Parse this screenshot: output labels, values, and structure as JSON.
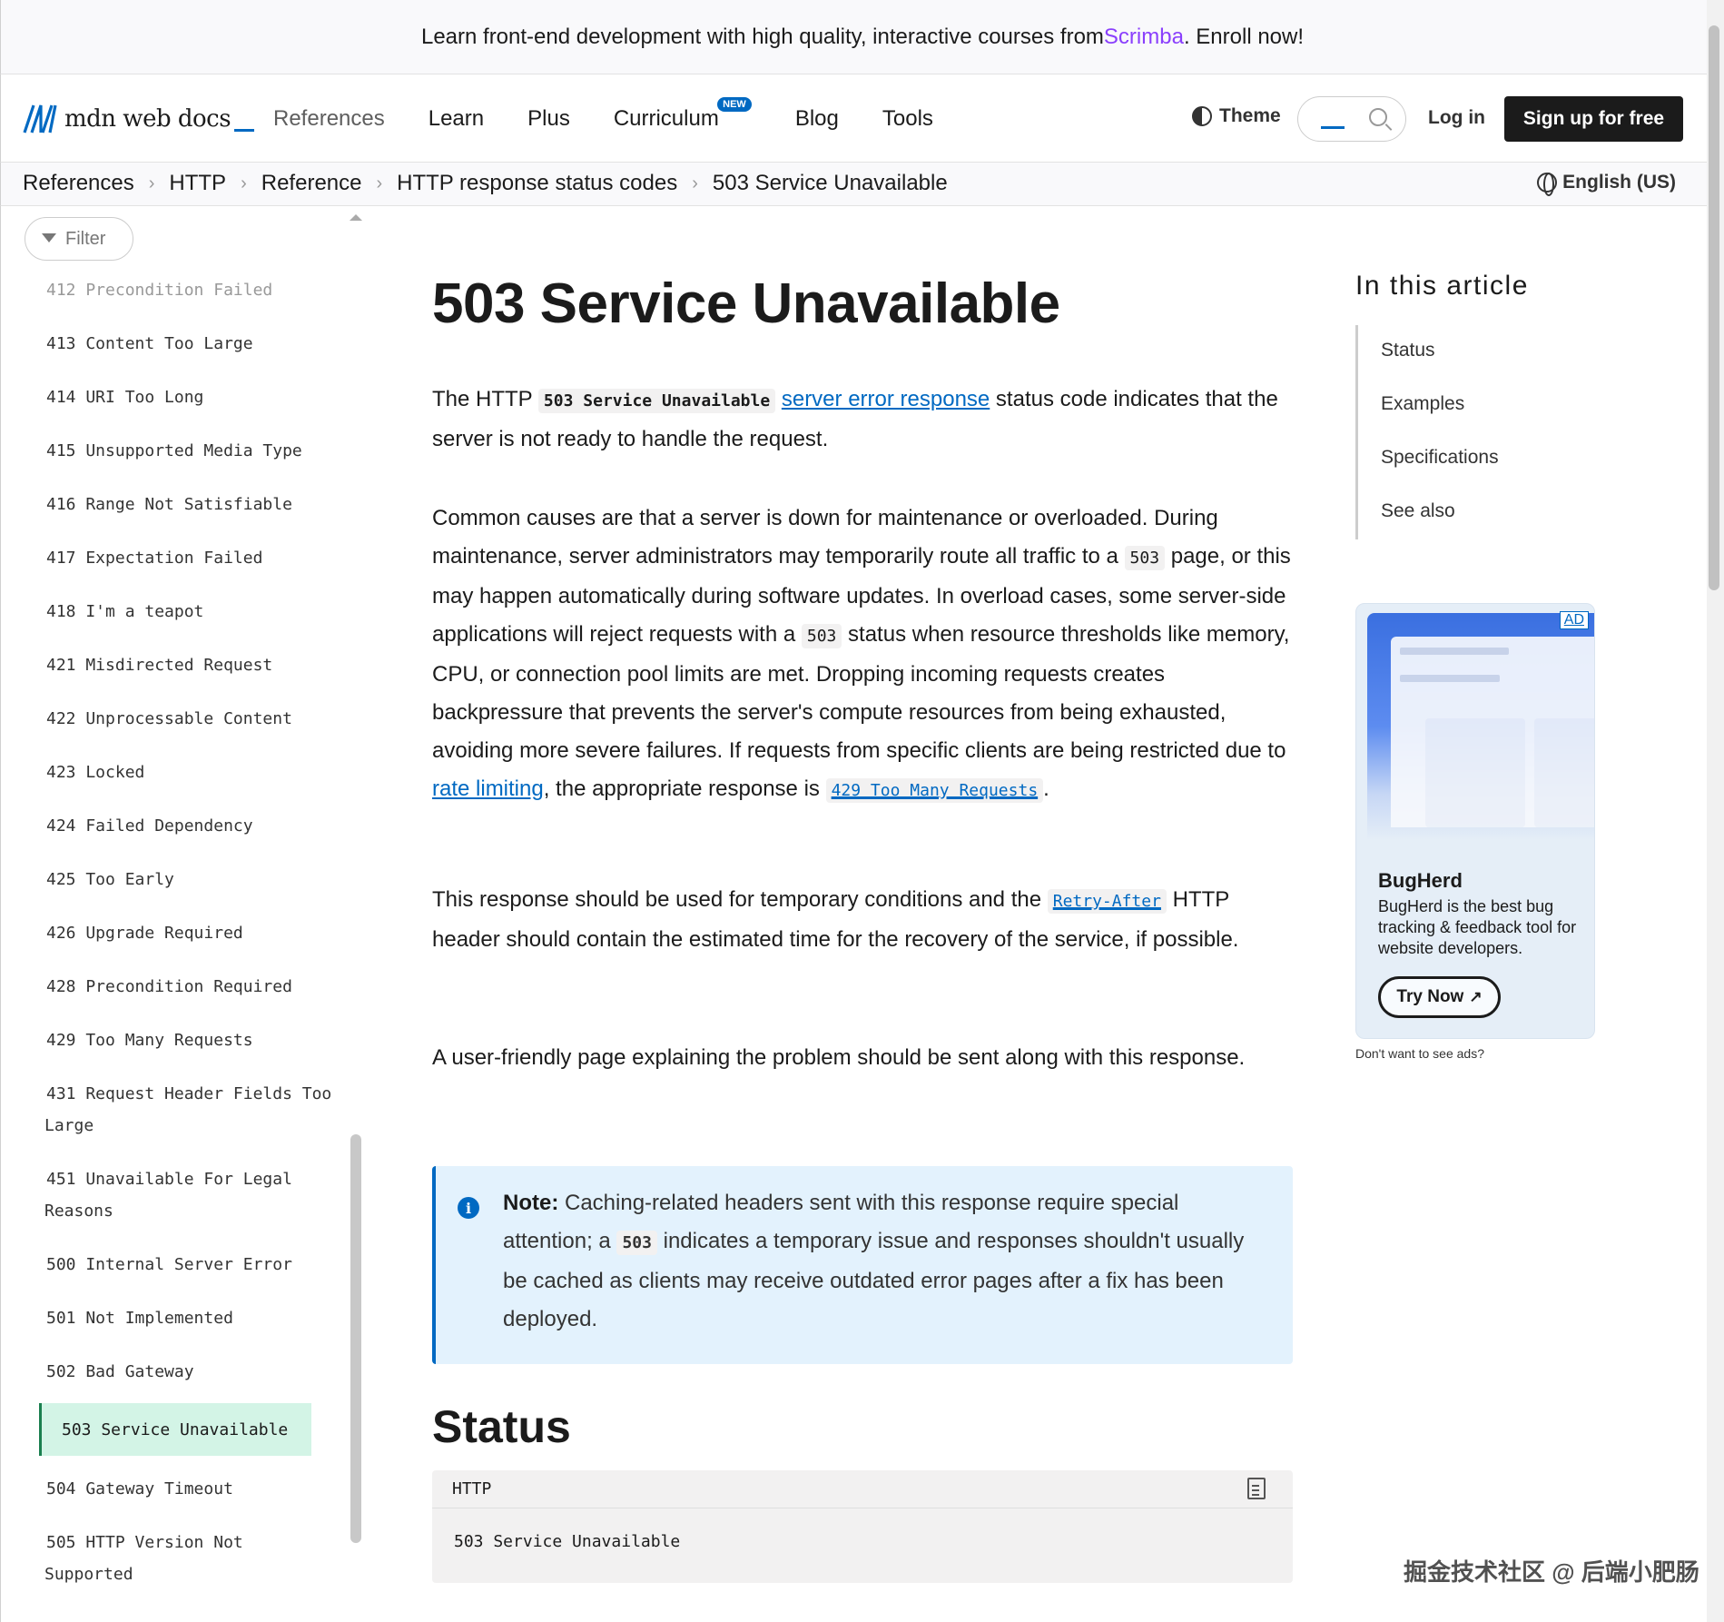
{
  "banner": {
    "text_before": "Learn front-end development with high quality, interactive courses from ",
    "brand": "Scrimba",
    "text_after": ". Enroll now!"
  },
  "header": {
    "logo_text": "mdn web docs",
    "nav": [
      {
        "label": "References"
      },
      {
        "label": "Learn"
      },
      {
        "label": "Plus"
      },
      {
        "label": "Curriculum",
        "badge": "NEW"
      },
      {
        "label": "Blog"
      },
      {
        "label": "Tools"
      }
    ],
    "theme_label": "Theme",
    "login_label": "Log in",
    "signup_label": "Sign up for free"
  },
  "breadcrumbs": [
    "References",
    "HTTP",
    "Reference",
    "HTTP response status codes",
    "503 Service Unavailable"
  ],
  "language": "English (US)",
  "sidebar": {
    "filter_label": "Filter",
    "items": [
      {
        "label": "412 Precondition Failed"
      },
      {
        "label": "413 Content Too Large"
      },
      {
        "label": "414 URI Too Long"
      },
      {
        "label": "415 Unsupported Media Type"
      },
      {
        "label": "416 Range Not Satisfiable"
      },
      {
        "label": "417 Expectation Failed"
      },
      {
        "label": "418 I'm a teapot"
      },
      {
        "label": "421 Misdirected Request"
      },
      {
        "label": "422 Unprocessable Content"
      },
      {
        "label": "423 Locked"
      },
      {
        "label": "424 Failed Dependency"
      },
      {
        "label": "425 Too Early"
      },
      {
        "label": "426 Upgrade Required"
      },
      {
        "label": "428 Precondition Required"
      },
      {
        "label": "429 Too Many Requests"
      },
      {
        "label": "431 Request Header Fields Too",
        "label2": "Large"
      },
      {
        "label": "451 Unavailable For Legal",
        "label2": "Reasons"
      },
      {
        "label": "500 Internal Server Error"
      },
      {
        "label": "501 Not Implemented"
      },
      {
        "label": "502 Bad Gateway"
      },
      {
        "label": "503 Service Unavailable",
        "active": true
      },
      {
        "label": "504 Gateway Timeout"
      },
      {
        "label": "505 HTTP Version Not",
        "label2": "Supported"
      }
    ]
  },
  "article": {
    "title": "503 Service Unavailable",
    "p1": {
      "t1": "The HTTP ",
      "code": "503 Service Unavailable",
      "link": "server error response",
      "t2": " status code indicates that the server is not ready to handle the request."
    },
    "p2": {
      "t1": "Common causes are that a server is down for maintenance or overloaded. During maintenance, server administrators may temporarily route all traffic to a ",
      "code1": "503",
      "t2": " page, or this may happen automatically during software updates. In overload cases, some server-side applications will reject requests with a ",
      "code2": "503",
      "t3": " status when resource thresholds like memory, CPU, or connection pool limits are met. Dropping incoming requests creates backpressure that prevents the server's compute resources from being exhausted, avoiding more severe failures. If requests from specific clients are being restricted due to ",
      "link": "rate limiting",
      "t4": ", the appropriate response is ",
      "code_link": "429 Too Many Requests",
      "t5": "."
    },
    "p3": {
      "t1": "This response should be used for temporary conditions and the ",
      "code_link": "Retry-After",
      "t2": " HTTP header should contain the estimated time for the recovery of the service, if possible."
    },
    "p4": "A user-friendly page explaining the problem should be sent along with this response.",
    "note": {
      "label": "Note:",
      "t1": " Caching-related headers sent with this response require special attention; a ",
      "code": "503",
      "t2": " indicates a temporary issue and responses shouldn't usually be cached as clients may receive outdated error pages after a fix has been deployed."
    },
    "status_heading": "Status",
    "code_lang": "HTTP",
    "code_text": "503 Service Unavailable"
  },
  "toc": {
    "title": "In this article",
    "items": [
      "Status",
      "Examples",
      "Specifications",
      "See also"
    ]
  },
  "ad": {
    "tag": "AD",
    "title": "BugHerd",
    "description": "BugHerd is the best bug tracking & feedback tool for website developers.",
    "button": "Try Now",
    "note": "Don't want to see ads?"
  },
  "watermark": "掘金技术社区 @ 后端小肥肠"
}
